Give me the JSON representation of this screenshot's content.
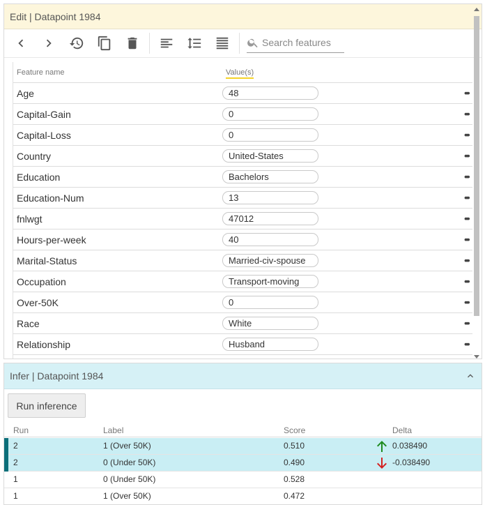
{
  "edit": {
    "title": "Edit | Datapoint 1984",
    "search_placeholder": "Search features",
    "columns": {
      "name": "Feature name",
      "value": "Value(s)"
    },
    "features": [
      {
        "name": "Age",
        "value": "48"
      },
      {
        "name": "Capital-Gain",
        "value": "0"
      },
      {
        "name": "Capital-Loss",
        "value": "0"
      },
      {
        "name": "Country",
        "value": "United-States"
      },
      {
        "name": "Education",
        "value": "Bachelors"
      },
      {
        "name": "Education-Num",
        "value": "13"
      },
      {
        "name": "fnlwgt",
        "value": "47012"
      },
      {
        "name": "Hours-per-week",
        "value": "40"
      },
      {
        "name": "Marital-Status",
        "value": "Married-civ-spouse"
      },
      {
        "name": "Occupation",
        "value": "Transport-moving"
      },
      {
        "name": "Over-50K",
        "value": "0"
      },
      {
        "name": "Race",
        "value": "White"
      },
      {
        "name": "Relationship",
        "value": "Husband"
      }
    ],
    "more_glyph": "•••"
  },
  "infer": {
    "title": "Infer | Datapoint 1984",
    "run_button": "Run inference",
    "columns": {
      "run": "Run",
      "label": "Label",
      "score": "Score",
      "delta": "Delta"
    },
    "rows": [
      {
        "run": "2",
        "label": "1 (Over 50K)",
        "score": "0.510",
        "delta": "0.038490",
        "highlight": true,
        "direction": "up"
      },
      {
        "run": "2",
        "label": "0 (Under 50K)",
        "score": "0.490",
        "delta": "-0.038490",
        "highlight": true,
        "direction": "down"
      },
      {
        "run": "1",
        "label": "0 (Under 50K)",
        "score": "0.528",
        "delta": "",
        "highlight": false,
        "direction": ""
      },
      {
        "run": "1",
        "label": "1 (Over 50K)",
        "score": "0.472",
        "delta": "",
        "highlight": false,
        "direction": ""
      }
    ]
  },
  "colors": {
    "up": "#1e8a1e",
    "down": "#d32222",
    "highlight": "#c9eef4",
    "marker": "#0b6e79"
  }
}
